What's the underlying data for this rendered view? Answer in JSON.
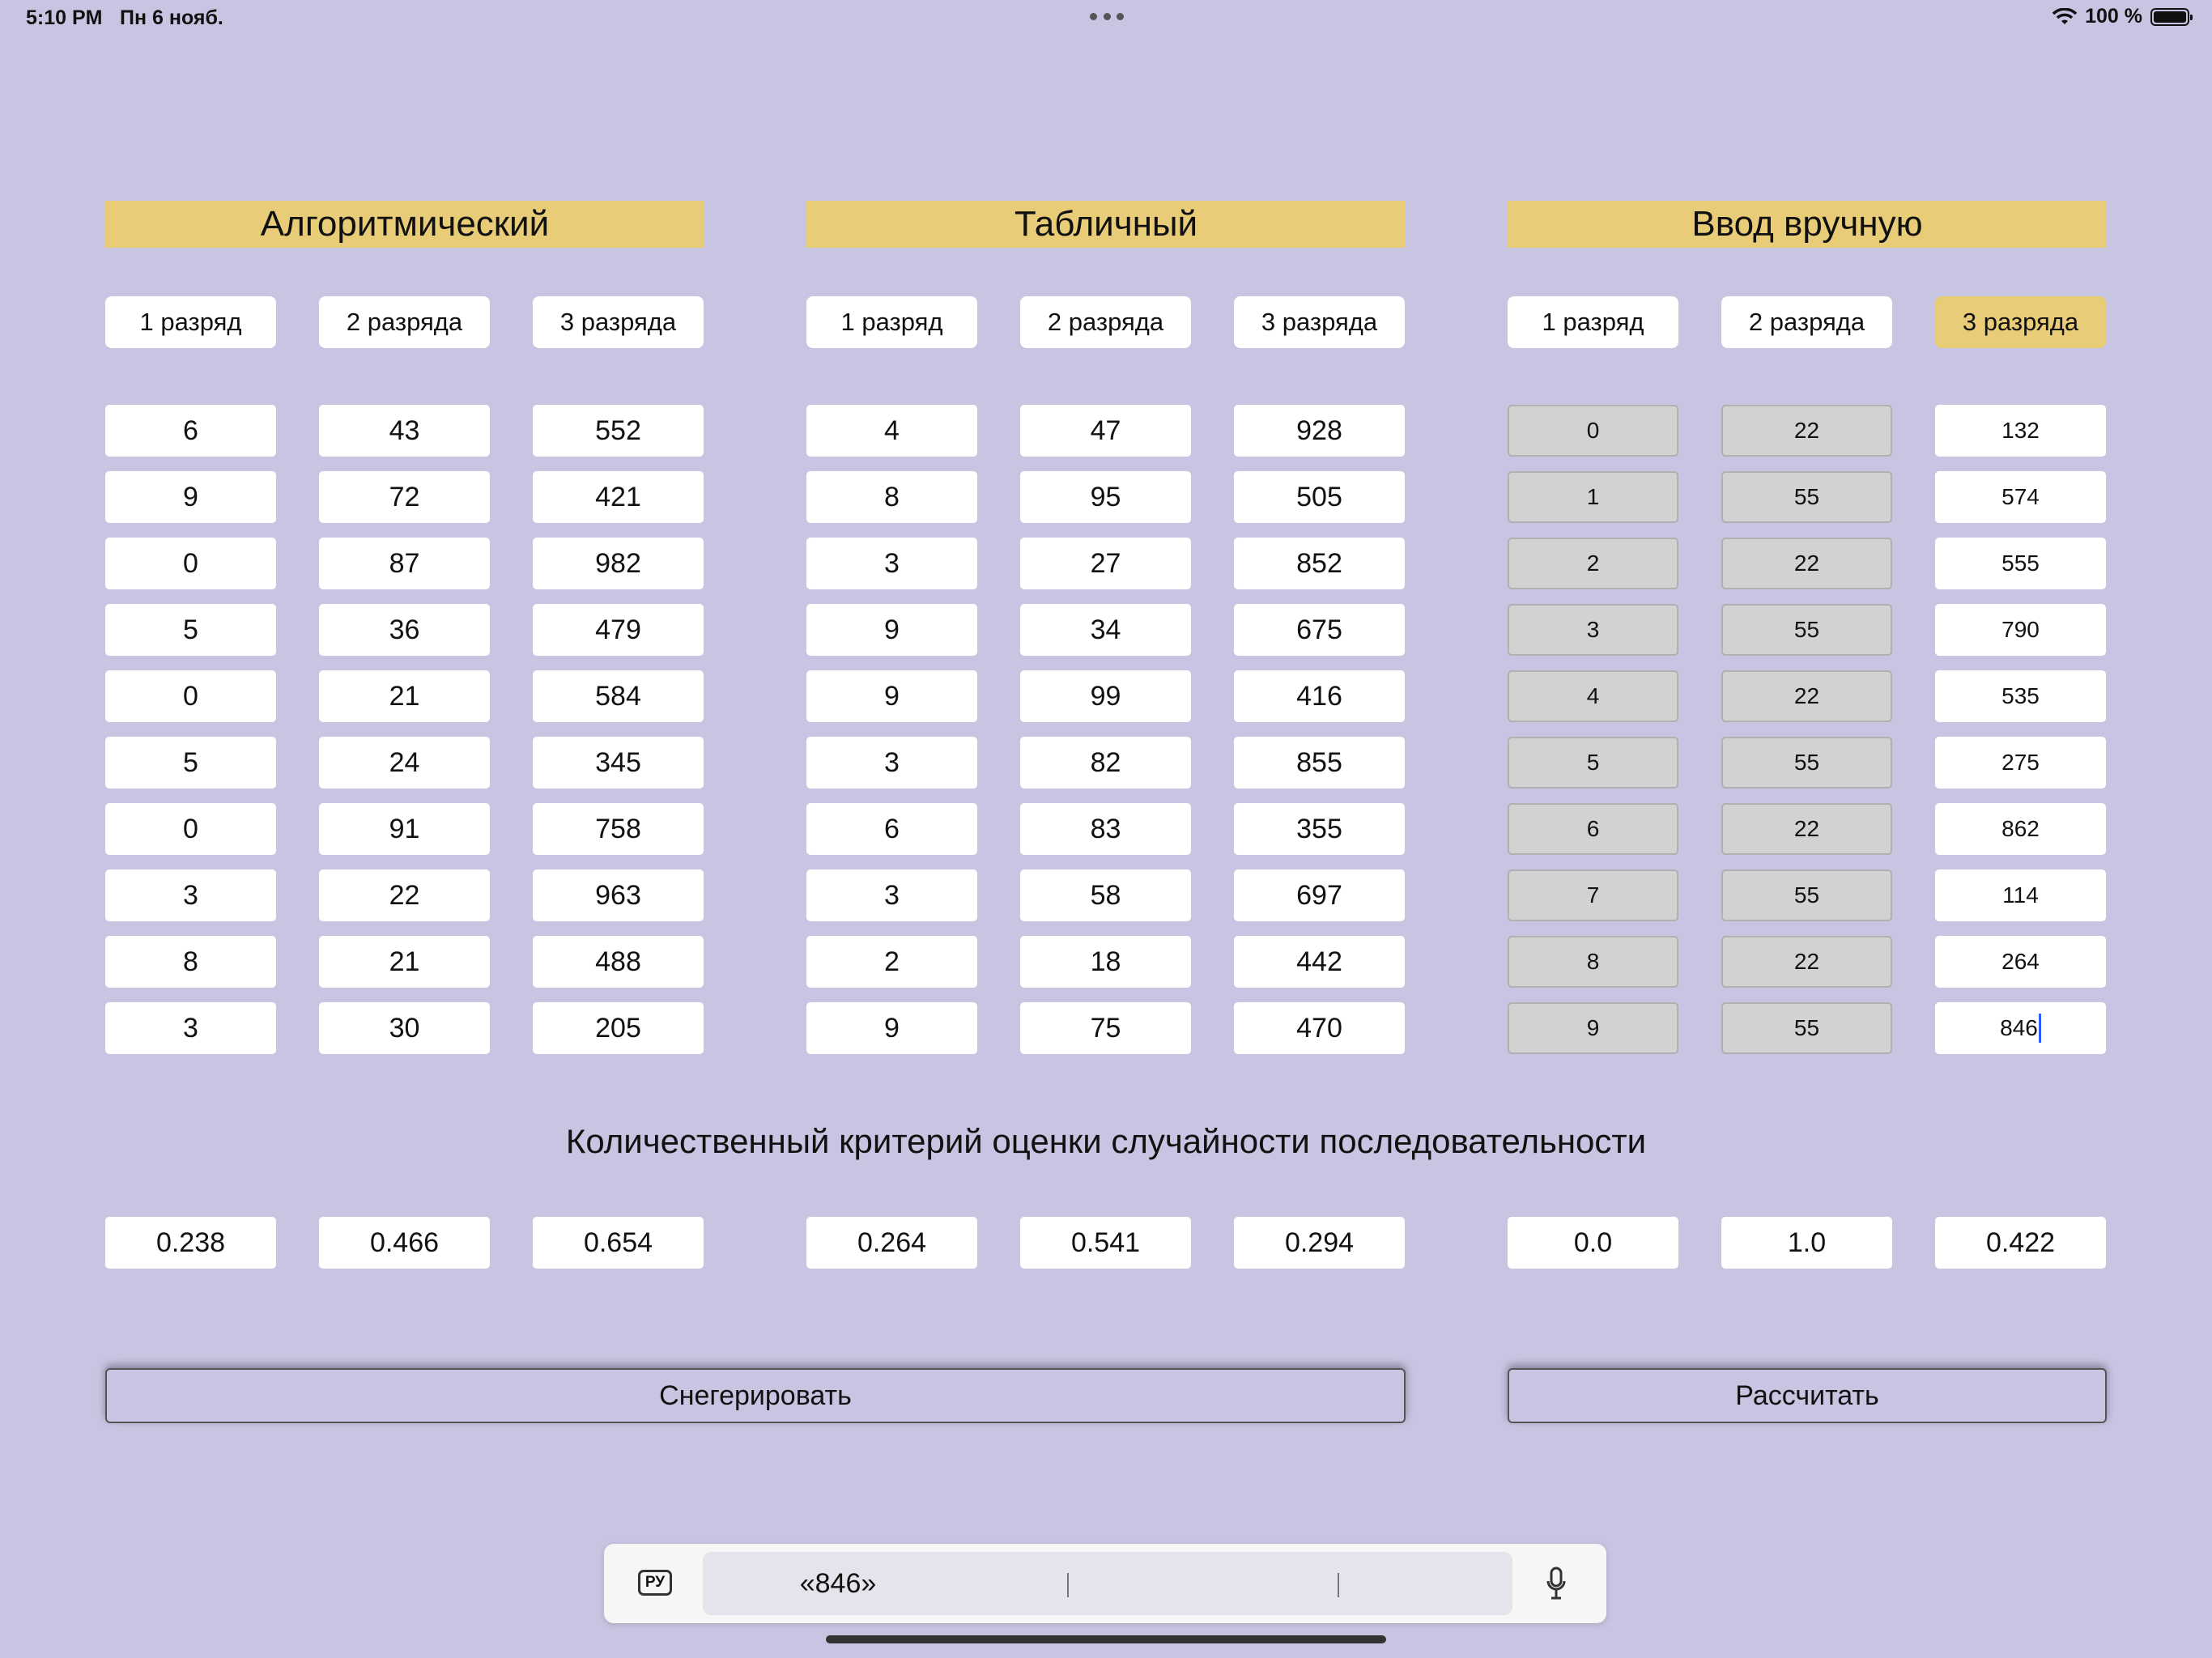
{
  "status_bar": {
    "time": "5:10 PM",
    "date": "Пн 6 нояб.",
    "battery": "100 %"
  },
  "sections": [
    {
      "title": "Алгоритмический",
      "buttons": [
        "1 разряд",
        "2 разряда",
        "3 разряда"
      ],
      "columns": [
        [
          "6",
          "9",
          "0",
          "5",
          "0",
          "5",
          "0",
          "3",
          "8",
          "3"
        ],
        [
          "43",
          "72",
          "87",
          "36",
          "21",
          "24",
          "91",
          "22",
          "21",
          "30"
        ],
        [
          "552",
          "421",
          "982",
          "479",
          "584",
          "345",
          "758",
          "963",
          "488",
          "205"
        ]
      ],
      "criteria": [
        "0.238",
        "0.466",
        "0.654"
      ]
    },
    {
      "title": "Табличный",
      "buttons": [
        "1 разряд",
        "2 разряда",
        "3 разряда"
      ],
      "columns": [
        [
          "4",
          "8",
          "3",
          "9",
          "9",
          "3",
          "6",
          "3",
          "2",
          "9"
        ],
        [
          "47",
          "95",
          "27",
          "34",
          "99",
          "82",
          "83",
          "58",
          "18",
          "75"
        ],
        [
          "928",
          "505",
          "852",
          "675",
          "416",
          "855",
          "355",
          "697",
          "442",
          "470"
        ]
      ],
      "criteria": [
        "0.264",
        "0.541",
        "0.294"
      ]
    },
    {
      "title": "Ввод вручную",
      "buttons": [
        "1 разряд",
        "2 разряда",
        "3 разряда"
      ],
      "selected_button": 2,
      "columns": [
        [
          "0",
          "1",
          "2",
          "3",
          "4",
          "5",
          "6",
          "7",
          "8",
          "9"
        ],
        [
          "22",
          "55",
          "22",
          "55",
          "22",
          "55",
          "22",
          "55",
          "22",
          "55"
        ],
        [
          "132",
          "574",
          "555",
          "790",
          "535",
          "275",
          "862",
          "114",
          "264",
          "846"
        ]
      ],
      "criteria": [
        "0.0",
        "1.0",
        "0.422"
      ]
    }
  ],
  "criterion_title": "Количественный критерий оценки случайности последовательности",
  "generate_button": "Снегерировать",
  "calculate_button": "Рассчитать",
  "keyboard": {
    "lang": "РУ",
    "suggestions": [
      "«846»",
      "",
      ""
    ]
  },
  "colors": {
    "background": "#c8c5e2",
    "accent": "#e8cc78",
    "cell": "#ffffff",
    "disabled_cell": "#d2d2d2"
  }
}
